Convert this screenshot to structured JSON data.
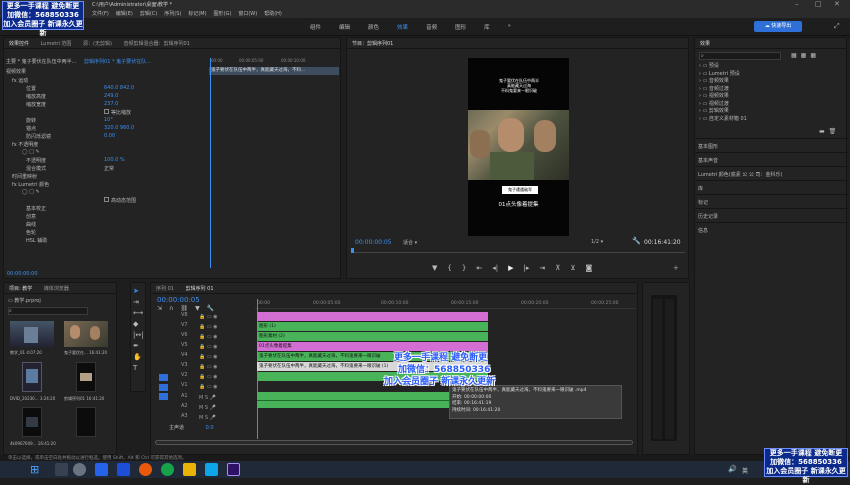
{
  "window": {
    "title": "C:\\用户\\Administrator\\桌面\\教学 *",
    "menu": [
      "文件(F)",
      "编辑(E)",
      "剪辑(C)",
      "序列(S)",
      "标记(M)",
      "图形(G)",
      "窗口(W)",
      "帮助(H)"
    ],
    "workspaces": [
      "组件",
      "编辑",
      "颜色",
      "效果",
      "音频",
      "图形",
      "库"
    ],
    "active_workspace": "效果",
    "share_button": "快速导出"
  },
  "promo": {
    "top_lines": [
      "更多一手课程 避免断更",
      "加微信：568850336",
      "加入会员圈子 新课永久更新"
    ],
    "overlay_lines": [
      "更多一手课程 避免断更",
      "加微信：568850336",
      "加入会员圈子 新课永久更新"
    ],
    "corner_lines": [
      "更多一手课程 避免断更",
      "加微信：568850336",
      "加入会员圈子 新课永久更新"
    ]
  },
  "effect_controls": {
    "tabs": [
      "效果控件",
      "Lumetri 范围",
      "源：(无剪辑)",
      "音频剪辑混合器：剪辑序列01"
    ],
    "source_line": "主要 * 鬼子要伏在队伍中两半...",
    "clip_line": "剪辑序列01 * 鬼子要伏在队...",
    "section": "视频效果",
    "rows": [
      {
        "label": "fx 运动",
        "value": ""
      },
      {
        "label": "位置",
        "value": "640.0   842.0"
      },
      {
        "label": "缩放高度",
        "value": "249.0"
      },
      {
        "label": "缩放宽度",
        "value": "237.0"
      },
      {
        "label": "",
        "value": "等比缩放"
      },
      {
        "label": "旋转",
        "value": "10°"
      },
      {
        "label": "锚点",
        "value": "320.0   960.0"
      },
      {
        "label": "防闪烁滤镜",
        "value": "0.00"
      },
      {
        "label": "fx 不透明度",
        "value": ""
      },
      {
        "label": "",
        "value": ""
      },
      {
        "label": "不透明度",
        "value": "100.0 %"
      },
      {
        "label": "混合模式",
        "value": "正常"
      },
      {
        "label": "时间重映射",
        "value": ""
      },
      {
        "label": "fx Lumetri 颜色",
        "value": ""
      },
      {
        "label": "",
        "value": ""
      },
      {
        "label": "",
        "value": "高动态范围"
      },
      {
        "label": "基本校正",
        "value": ""
      },
      {
        "label": "创意",
        "value": ""
      },
      {
        "label": "曲线",
        "value": ""
      },
      {
        "label": "色轮",
        "value": ""
      },
      {
        "label": "HSL 辅助",
        "value": ""
      }
    ],
    "clip_bar_text": "鬼子要伏在队伍中两半，真能藏天过海，不料...",
    "timecode": "00:00:00:00",
    "ruler": [
      "00:00",
      "00:00:05:00",
      "00:00:10:00"
    ]
  },
  "program": {
    "tab": "节目：剪辑序列01",
    "timecode": "00:00:00:05",
    "fit": "适合",
    "quality": "1/2",
    "duration": "00:16:41:20",
    "video_caption_top": "鬼子要伏在队伍中两半\n真能藏天过海\n不料鬼要来一眼识破",
    "subtitle_1": "鬼子遭遇敌军",
    "subtitle_2": "01点头像着提集"
  },
  "effects_panel": {
    "tab": "效果",
    "tree": [
      "预设",
      "Lumetri 预设",
      "音频效果",
      "音频过渡",
      "视频效果",
      "视频过渡",
      "剪辑效果",
      "自定义素材箱 01"
    ],
    "other_panels": [
      "基本图形",
      "基本声音",
      "Lumetri 颜色(底素 公 公 司：金科乐)",
      "库",
      "标记",
      "历史记录",
      "信息"
    ]
  },
  "project": {
    "tabs": [
      "项目: 教学",
      "媒体浏览器"
    ],
    "path": "教学.prproj",
    "search_placeholder": "",
    "items": [
      {
        "name": "教学_01",
        "duration": "4:07:20"
      },
      {
        "name": "鬼子要伏在...",
        "duration": "16:41:20"
      },
      {
        "name": "DVID_20230...",
        "duration": "3:24:20"
      },
      {
        "name": "剪辑序列01",
        "duration": "16:41:20"
      },
      {
        "name": "4k0967609...",
        "duration": "16:41:20"
      },
      {
        "name": "...",
        "duration": ""
      }
    ]
  },
  "timeline": {
    "tabs": [
      "序列 01",
      "剪辑序列 01"
    ],
    "timecode": "00:00:00:05",
    "ruler": [
      "00:00",
      "00:00:05:00",
      "00:00:10:00",
      "00:00:15:00",
      "00:00:20:00",
      "00:00:25:00"
    ],
    "video_tracks": [
      "V8",
      "V7",
      "V6",
      "V5",
      "V4",
      "V3",
      "V2",
      "V1"
    ],
    "audio_tracks": [
      "A1",
      "A2",
      "A3"
    ],
    "master": {
      "label": "主声道",
      "value": "0.0"
    },
    "clips": [
      {
        "label": "",
        "color": "#d36fd3"
      },
      {
        "label": "图形 (1)",
        "color": "#49b35a"
      },
      {
        "label": "图形素材 (2)",
        "color": "#49b35a"
      },
      {
        "label": "01点头像着提集",
        "color": "#d36fd3"
      },
      {
        "label": "鬼子要伏在队伍中两半，真能藏天过海，不料鬼要来一眼识破",
        "color": "#49b35a"
      },
      {
        "label": "鬼子要伏在队伍中两半，真能藏天过海，不料鬼要来一眼识破 (1)",
        "color": "#d8d8d8"
      },
      {
        "label": "",
        "color": "#49b35a"
      },
      {
        "label": "",
        "color": "#49b35a"
      }
    ],
    "tooltip": {
      "title": "鬼子要伏在队伍中两半，真能藏天过海，不料鬼要来一眼识破 .mp4",
      "start": "开始: 00:00:00:00",
      "end": "结束: 00:16:41:19",
      "duration": "持续时间: 00:16:41:20"
    }
  },
  "status_bar": "单击以选择，或单击空白处并拖动以进行框选。使用 Shift、Alt 和 Ctrl 可获得其他选项。",
  "taskbar": {
    "time": "",
    "lang": "英"
  },
  "colors": {
    "accent_blue": "#3b8ff0",
    "clip_green": "#49b35a",
    "clip_pink": "#d36fd3",
    "promo_blue": "#0b2a8c"
  }
}
